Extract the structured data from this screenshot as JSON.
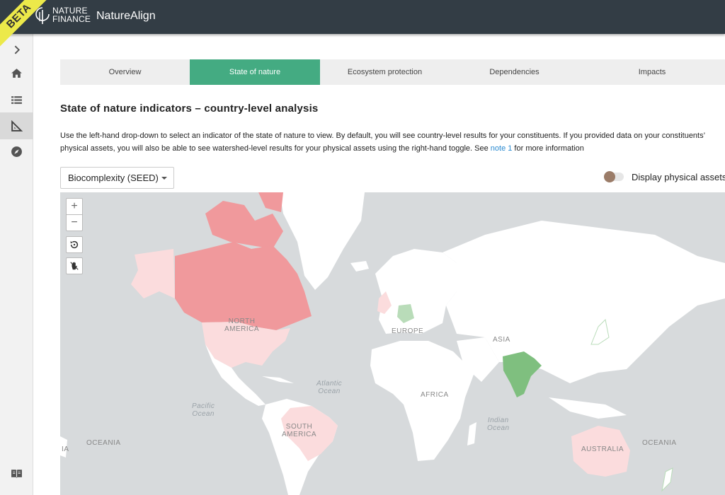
{
  "header": {
    "beta": "BETA",
    "logo_line1": "NATURE",
    "logo_line2": "FINANCE",
    "app_title": "NatureAlign"
  },
  "sidebar": {
    "items": [
      {
        "icon": "chevron-right-icon"
      },
      {
        "icon": "home-icon"
      },
      {
        "icon": "list-icon"
      },
      {
        "icon": "set-square-icon"
      },
      {
        "icon": "compass-icon"
      },
      {
        "icon": "book-icon"
      }
    ]
  },
  "tabs": [
    {
      "label": "Overview"
    },
    {
      "label": "State of nature"
    },
    {
      "label": "Ecosystem protection"
    },
    {
      "label": "Dependencies"
    },
    {
      "label": "Impacts"
    }
  ],
  "main": {
    "heading": "State of nature indicators – country-level analysis",
    "desc_part1": "Use the left-hand drop-down to select an indicator of the state of nature to view. By default, you will see country-level results for your constituents. If you provided data on your constituents’ physical assets, you will also be able to see watershed-level results for your physical assets using the right-hand toggle. See ",
    "desc_link": "note 1",
    "desc_part2": " for more information",
    "dropdown_value": "Biocomplexity (SEED)",
    "toggle_label": "Display physical assets"
  },
  "map": {
    "controls": {
      "zoom_in": "+",
      "zoom_out": "−"
    },
    "regions": [
      {
        "line1": "NORTH",
        "line2": "AMERICA"
      },
      {
        "line1": "EUROPE",
        "line2": ""
      },
      {
        "line1": "ASIA",
        "line2": ""
      },
      {
        "line1": "AFRICA",
        "line2": ""
      },
      {
        "line1": "SOUTH",
        "line2": "AMERICA"
      },
      {
        "line1": "AUSTRALIA",
        "line2": ""
      },
      {
        "line1": "OCEANIA",
        "line2": ""
      },
      {
        "line1": "OCEANIA",
        "line2": ""
      },
      {
        "line1": "IA",
        "line2": ""
      }
    ],
    "oceans": [
      {
        "line1": "Atlantic",
        "line2": "Ocean"
      },
      {
        "line1": "Pacific",
        "line2": "Ocean"
      },
      {
        "line1": "Indian",
        "line2": "Ocean"
      }
    ],
    "colors": {
      "ocean": "#d7dadc",
      "land": "#ffffff",
      "canada": "#f0999c",
      "usa": "#fbdcdd",
      "brazil": "#fbdcdd",
      "australia": "#fbdcdd",
      "india": "#7fbf7f",
      "germany": "#b9dcb9"
    }
  }
}
